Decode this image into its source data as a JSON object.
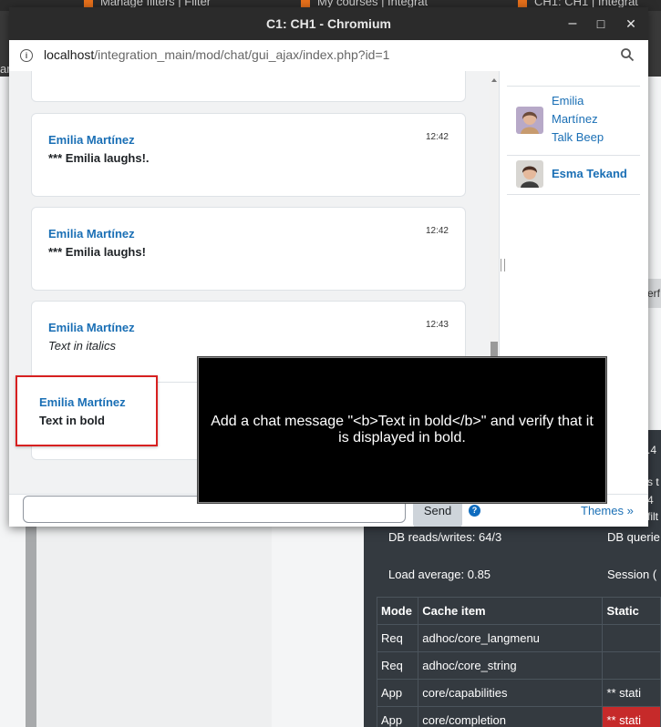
{
  "background": {
    "tabs": [
      "Manage filters | Filter",
      "My courses | Integrat",
      "CH1: CH1 | Integrat"
    ],
    "edge_fragments": {
      "nav": "ar",
      "button": "erf",
      "stat1": ".4",
      "stat2": "s t",
      "stat3": "4",
      "stat4": "filt"
    },
    "perf": {
      "db_reads_writes": "DB reads/writes: 64/3",
      "db_queries": "DB querie",
      "load_average": "Load average: 0.85",
      "session": "Session (",
      "cache_headers": [
        "Mode",
        "Cache item",
        "Static"
      ],
      "cache_rows": [
        {
          "mode": "Req",
          "item": "adhoc/core_langmenu",
          "static": ""
        },
        {
          "mode": "Req",
          "item": "adhoc/core_string",
          "static": ""
        },
        {
          "mode": "App",
          "item": "core/capabilities",
          "static": "** stati"
        },
        {
          "mode": "App",
          "item": "core/completion",
          "static": "** stati"
        }
      ]
    }
  },
  "window": {
    "title": "C1: CH1 - Chromium",
    "url_host": "localhost",
    "url_path": "/integration_main/mod/chat/gui_ajax/index.php?id=1",
    "buttons": [
      "–",
      "□",
      "✕"
    ]
  },
  "messages": [
    {
      "author": "Emilia Martínez",
      "time": "12:42",
      "text": "*** Emilia laughs!."
    },
    {
      "author": "Emilia Martínez",
      "time": "12:42",
      "text": "*** Emilia laughs!"
    },
    {
      "author": "Emilia Martínez",
      "time": "12:43",
      "text": "Text in italics"
    },
    {
      "author": "Emilia Martínez",
      "time": "",
      "text": "Text in bold"
    }
  ],
  "users": [
    {
      "name_lines": [
        "Emilia",
        "Martínez",
        "Talk Beep"
      ]
    },
    {
      "name": "Esma Tekand"
    }
  ],
  "input": {
    "value": "",
    "placeholder": ""
  },
  "send_label": "Send",
  "help_glyph": "?",
  "themes_label": "Themes »",
  "instruction": "Add a chat message \"<b>Text in bold</b>\" and verify that it is displayed in bold.",
  "colors": {
    "link": "#1a6fb5",
    "highlight": "#d72020",
    "perf_bg": "#343a40",
    "warn": "#c62a2a"
  },
  "icons": [
    "info-icon",
    "zoom-icon",
    "help-icon",
    "minimize-icon",
    "maximize-icon",
    "close-icon"
  ]
}
